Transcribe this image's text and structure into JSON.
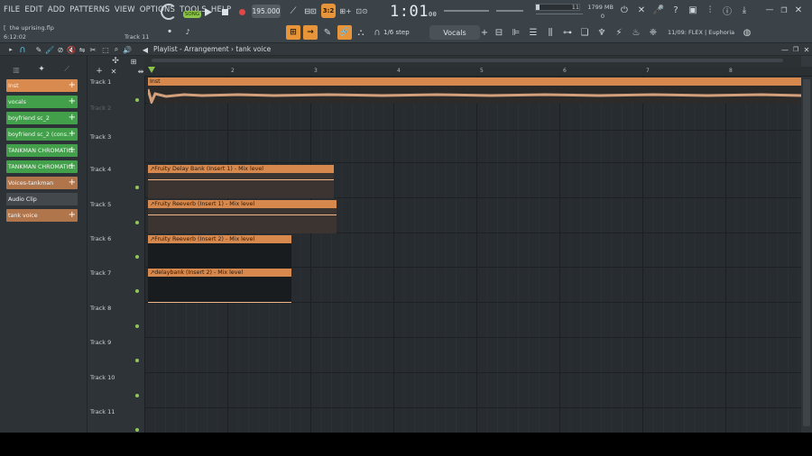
{
  "menu": [
    "FILE",
    "EDIT",
    "ADD",
    "PATTERNS",
    "VIEW",
    "OPTIONS",
    "TOOLS",
    "HELP"
  ],
  "project": {
    "name": "the uprising.flp",
    "time": "6:12:02",
    "current_track": "Track 11"
  },
  "transport": {
    "mode": "SONG",
    "tempo": "195.000",
    "time": "1:01",
    "time_small": "00"
  },
  "cpu": {
    "voices": "11",
    "memory": "1799 MB",
    "cpu": "0"
  },
  "toolbar2": {
    "snap": "1/6 step",
    "pattern": "Vocals",
    "news": "11/09: FLEX | Euphoria"
  },
  "playlist": {
    "title": "Playlist - Arrangement",
    "separator": "›",
    "name": "tank voice"
  },
  "ruler": [
    "2",
    "3",
    "4",
    "5",
    "6",
    "7",
    "8"
  ],
  "channels": [
    {
      "label": "Inst",
      "color": "#d98a4e"
    },
    {
      "label": "vocals",
      "color": "#43a04a"
    },
    {
      "label": "boyfriend sc_2",
      "color": "#43a04a"
    },
    {
      "label": "boyfriend sc_2 (cons..",
      "color": "#43a04a"
    },
    {
      "label": "TANKMAN CHROMATIC..",
      "color": "#43a04a"
    },
    {
      "label": "TANKMAN CHROMATIC..",
      "color": "#43a04a"
    },
    {
      "label": "Voices-tankman",
      "color": "#b0754a"
    },
    {
      "label": "Audio Clip",
      "color": "#43484d"
    },
    {
      "label": "tank voice",
      "color": "#b0754a"
    }
  ],
  "tracks": [
    "Track 1",
    "Track 2",
    "Track 3",
    "Track 4",
    "Track 5",
    "Track 6",
    "Track 7",
    "Track 8",
    "Track 9",
    "Track 10",
    "Track 11"
  ],
  "clips": [
    {
      "label": "Inst"
    },
    {
      "label": "Fruity Delay Bank (Insert 1) - Mix level"
    },
    {
      "label": "Fruity Reeverb (Insert 1) - Mix level"
    },
    {
      "label": "Fruity Reeverb (Insert 2) - Mix level"
    },
    {
      "label": "delaybank (Insert 2) - Mix level"
    }
  ],
  "colors": {
    "accent": "#e8953a",
    "clip": "#d6884d",
    "channel_green": "#43a04a",
    "led_green": "#93c556"
  }
}
